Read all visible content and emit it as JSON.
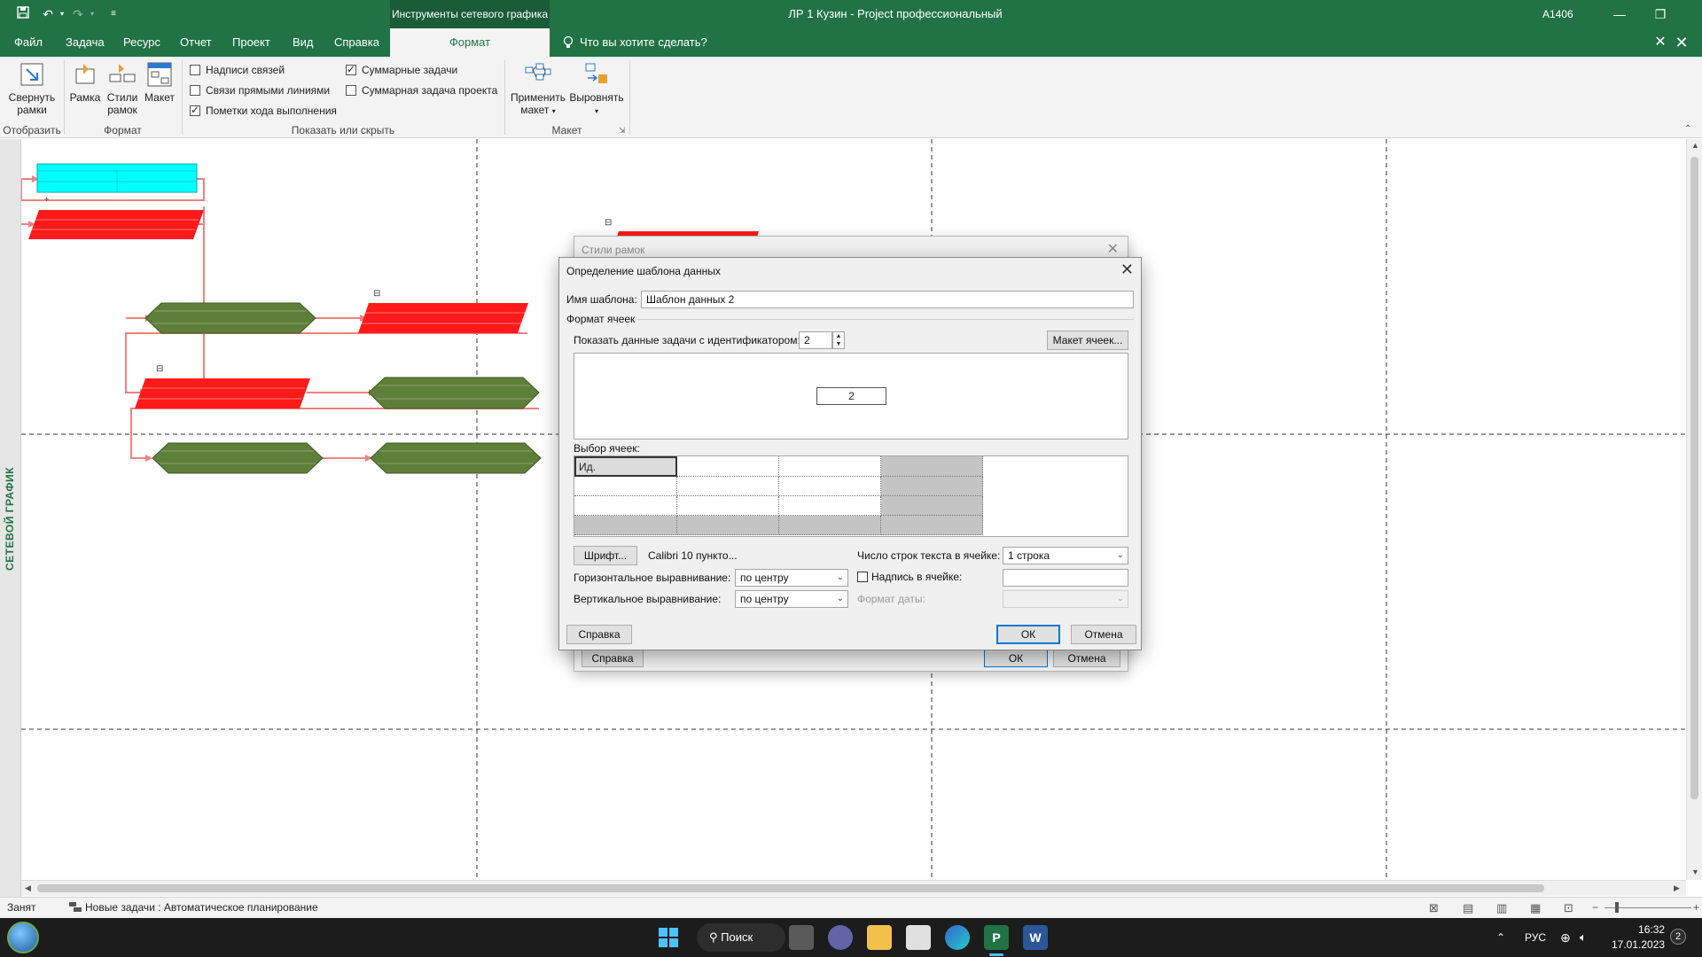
{
  "titlebar": {
    "context_tab": "Инструменты сетевого графика",
    "title": "ЛР 1 Кузин  -  Project профессиональный",
    "user": "A1406",
    "save_icon": "save-icon",
    "undo_icon": "undo-icon",
    "redo_icon": "redo-icon",
    "customize_icon": "customize-qat-icon"
  },
  "tabs": {
    "file": "Файл",
    "task": "Задача",
    "resource": "Ресурс",
    "report": "Отчет",
    "project": "Проект",
    "view": "Вид",
    "help": "Справка",
    "format": "Формат",
    "tell_me": "Что вы хотите сделать?"
  },
  "ribbon": {
    "collapse": "Свернуть рамки",
    "collapse_l1": "Свернуть",
    "collapse_l2": "рамки",
    "box": "Рамка",
    "box_styles_l1": "Стили",
    "box_styles_l2": "рамок",
    "layout": "Макет",
    "chk_link_labels": "Надписи связей",
    "chk_straight_links": "Связи прямыми линиями",
    "chk_progress_marks": "Пометки хода выполнения",
    "chk_summary_tasks": "Суммарные задачи",
    "chk_project_summary": "Суммарная задача проекта",
    "apply_layout_l1": "Применить",
    "apply_layout_l2": "макет",
    "align": "Выровнять",
    "group_show": "Отобразить",
    "group_format": "Формат",
    "group_show_hide": "Показать или скрыть",
    "group_layout": "Макет"
  },
  "side_label": "СЕТЕВОЙ ГРАФИК",
  "back_dialog": {
    "title": "Стили рамок",
    "help": "Справка",
    "ok": "ОК",
    "cancel": "Отмена"
  },
  "dialog": {
    "title": "Определение шаблона данных",
    "template_name_label": "Имя шаблона:",
    "template_name_value": "Шаблон данных 2",
    "cell_format_label": "Формат ячеек",
    "show_task_label": "Показать данные задачи с идентификатором:",
    "show_task_value": "2",
    "cell_layout_btn": "Макет ячеек...",
    "preview_value": "2",
    "choose_cells_label": "Выбор ячеек:",
    "first_cell": "Ид.",
    "font_btn": "Шрифт...",
    "font_value": "Calibri 10 пункто...",
    "rows_label": "Число строк текста в ячейке:",
    "rows_value": "1 строка",
    "h_align_label": "Горизонтальное выравнивание:",
    "h_align_value": "по центру",
    "v_align_label": "Вертикальное выравнивание:",
    "v_align_value": "по центру",
    "cell_label_chk": "Надпись в ячейке:",
    "date_format_label": "Формат даты:",
    "help_btn": "Справка",
    "ok_btn": "ОК",
    "cancel_btn": "Отмена"
  },
  "status": {
    "state": "Занят",
    "new_tasks": "Новые задачи : Автоматическое планирование"
  },
  "taskbar": {
    "search": "Поиск",
    "lang": "РУС",
    "time": "16:32",
    "date": "17.01.2023",
    "notif_count": "2"
  },
  "colors": {
    "accent": "#217346",
    "summary_box": "#00ffff",
    "critical_box": "#ff0000",
    "normal_box": "#5e7f3a"
  }
}
